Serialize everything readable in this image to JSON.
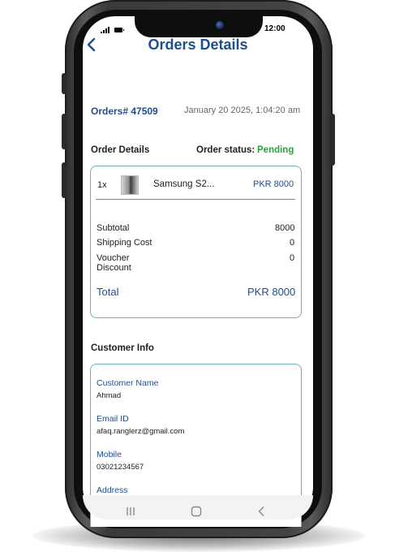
{
  "status_bar": {
    "time": "12:00"
  },
  "header": {
    "title": "Orders Details",
    "back_icon": "chevron-left-icon"
  },
  "order": {
    "number": "Orders# 47509",
    "date": "January 20 2025, 1:04:20 am",
    "details_heading": "Order Details",
    "status_label": "Order status:",
    "status_value": "Pending",
    "item": {
      "qty": "1x",
      "name": "Samsung S2...",
      "price": "PKR 8000"
    },
    "summary": {
      "subtotal_label": "Subtotal",
      "subtotal_value": "8000",
      "shipping_label": "Shipping Cost",
      "shipping_value": "0",
      "voucher_label_1": "Voucher",
      "voucher_label_2": "Discount",
      "voucher_value": "0",
      "total_label": "Total",
      "total_value": "PKR 8000"
    }
  },
  "customer": {
    "heading": "Customer Info",
    "name_label": "Customer Name",
    "name_value": "Ahmad",
    "email_label": "Email ID",
    "email_value": "afaq.ranglerz@gmail.com",
    "mobile_label": "Mobile",
    "mobile_value": "03021234567",
    "address_label": "Address"
  },
  "nav_bar": {
    "icons": [
      "recent-apps-icon",
      "home-icon",
      "back-icon"
    ]
  },
  "colors": {
    "brand_blue": "#1f4e8c",
    "status_green": "#2e9e3f",
    "card_border": "#6fb1b8"
  }
}
